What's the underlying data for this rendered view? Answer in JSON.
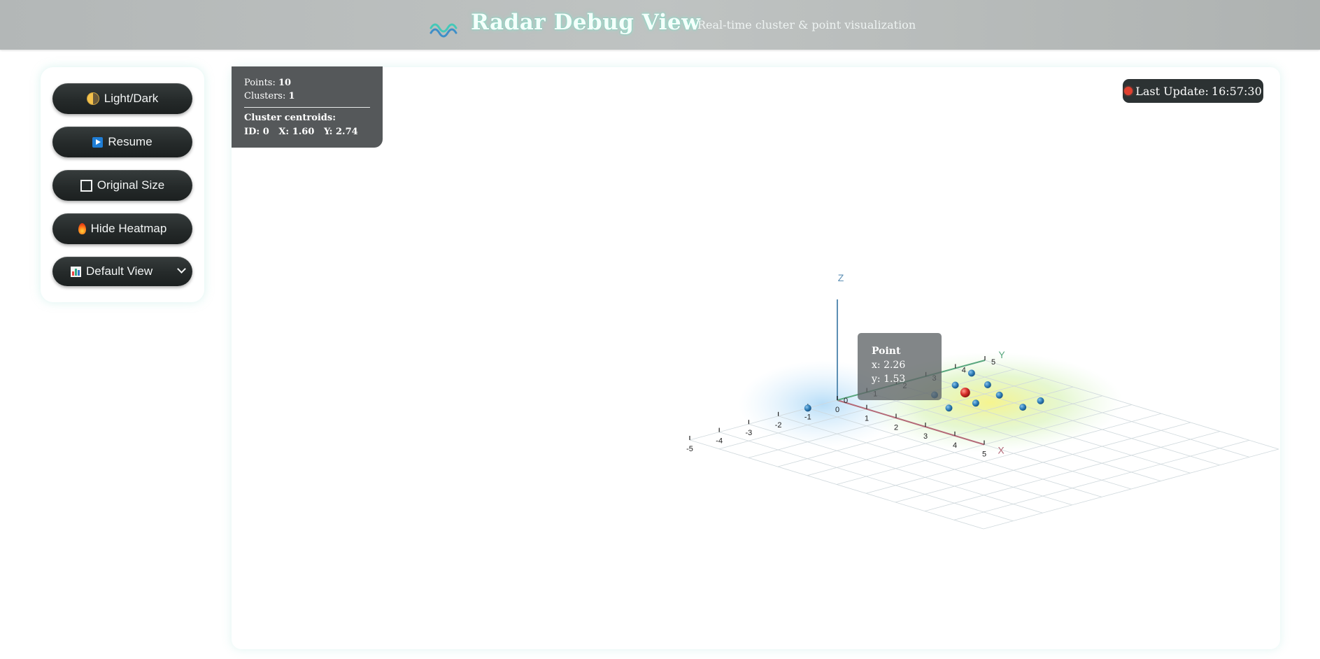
{
  "header": {
    "title": "Radar Debug View",
    "subtitle": "Real-time cluster & point visualization",
    "logo_icon": "wave-icon"
  },
  "controls": {
    "light_dark": {
      "label": "Light/Dark",
      "icon": "half-moon-icon"
    },
    "resume": {
      "label": "Resume",
      "icon": "play-icon"
    },
    "original_size": {
      "label": "Original Size",
      "icon": "square-icon"
    },
    "hide_heatmap": {
      "label": "Hide Heatmap",
      "icon": "fire-icon"
    },
    "view_select": {
      "selected": "Default View",
      "icon": "bar-chart-icon"
    }
  },
  "stats": {
    "points_label": "Points:",
    "points_value": "10",
    "clusters_label": "Clusters:",
    "clusters_value": "1",
    "centroids_heading": "Cluster centroids:",
    "centroid_id_label": "ID:",
    "centroid_id": "0",
    "centroid_x_label": "X:",
    "centroid_x": "1.60",
    "centroid_y_label": "Y:",
    "centroid_y": "2.74"
  },
  "status": {
    "last_update_label": "Last Update:",
    "last_update_time": "16:57:30",
    "indicator_color": "#e0402f"
  },
  "tooltip": {
    "title": "Point",
    "x_label": "x:",
    "x_value": "2.26",
    "y_label": "y:",
    "y_value": "1.53"
  },
  "colors": {
    "point": "#2f7fb8",
    "centroid": "#d9302a",
    "x_axis": "#b46a78",
    "y_axis": "#5aa87f",
    "z_axis": "#5c8fb4"
  },
  "chart_data": {
    "type": "scatter",
    "axis_labels": {
      "x": "X",
      "y": "Y",
      "z": "Z"
    },
    "x_ticks": [
      "0",
      "1",
      "2",
      "3",
      "4",
      "5"
    ],
    "y_ticks": [
      "-5",
      "-4",
      "-3",
      "-2",
      "-1",
      "0",
      "1",
      "2",
      "3",
      "4",
      "5"
    ],
    "xlim": [
      0,
      5
    ],
    "ylim": [
      -5,
      5
    ],
    "grid": true,
    "points": [
      {
        "x": 0.0,
        "y": -1.0,
        "z": 0
      },
      {
        "x": 0.55,
        "y": 4.0,
        "z": 0
      },
      {
        "x": 1.0,
        "y": 3.0,
        "z": 0
      },
      {
        "x": 1.25,
        "y": 2.05,
        "z": 0
      },
      {
        "x": 1.5,
        "y": 3.6,
        "z": 0
      },
      {
        "x": 2.26,
        "y": 1.53,
        "z": 0
      },
      {
        "x": 2.3,
        "y": 3.2,
        "z": 0
      },
      {
        "x": 2.4,
        "y": 2.3,
        "z": 0
      },
      {
        "x": 3.4,
        "y": 2.9,
        "z": 0
      },
      {
        "x": 3.3,
        "y": 3.6,
        "z": 0
      }
    ],
    "centroids": [
      {
        "id": 0,
        "x": 1.6,
        "y": 2.74
      }
    ]
  }
}
